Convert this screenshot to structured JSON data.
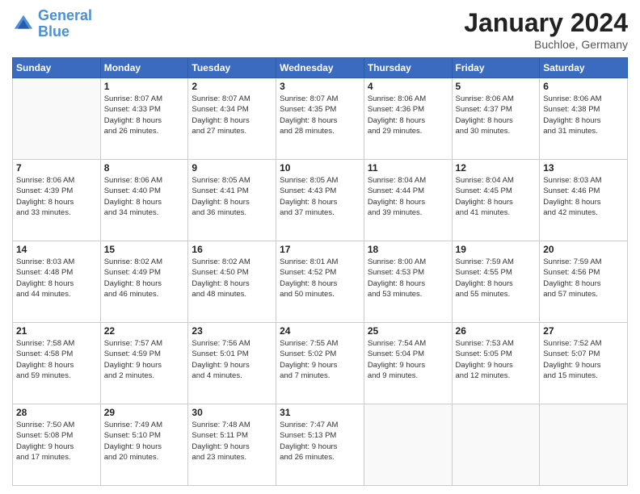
{
  "header": {
    "logo_line1": "General",
    "logo_line2": "Blue",
    "month_title": "January 2024",
    "location": "Buchloe, Germany"
  },
  "weekdays": [
    "Sunday",
    "Monday",
    "Tuesday",
    "Wednesday",
    "Thursday",
    "Friday",
    "Saturday"
  ],
  "weeks": [
    [
      {
        "day": "",
        "info": ""
      },
      {
        "day": "1",
        "info": "Sunrise: 8:07 AM\nSunset: 4:33 PM\nDaylight: 8 hours\nand 26 minutes."
      },
      {
        "day": "2",
        "info": "Sunrise: 8:07 AM\nSunset: 4:34 PM\nDaylight: 8 hours\nand 27 minutes."
      },
      {
        "day": "3",
        "info": "Sunrise: 8:07 AM\nSunset: 4:35 PM\nDaylight: 8 hours\nand 28 minutes."
      },
      {
        "day": "4",
        "info": "Sunrise: 8:06 AM\nSunset: 4:36 PM\nDaylight: 8 hours\nand 29 minutes."
      },
      {
        "day": "5",
        "info": "Sunrise: 8:06 AM\nSunset: 4:37 PM\nDaylight: 8 hours\nand 30 minutes."
      },
      {
        "day": "6",
        "info": "Sunrise: 8:06 AM\nSunset: 4:38 PM\nDaylight: 8 hours\nand 31 minutes."
      }
    ],
    [
      {
        "day": "7",
        "info": "Sunrise: 8:06 AM\nSunset: 4:39 PM\nDaylight: 8 hours\nand 33 minutes."
      },
      {
        "day": "8",
        "info": "Sunrise: 8:06 AM\nSunset: 4:40 PM\nDaylight: 8 hours\nand 34 minutes."
      },
      {
        "day": "9",
        "info": "Sunrise: 8:05 AM\nSunset: 4:41 PM\nDaylight: 8 hours\nand 36 minutes."
      },
      {
        "day": "10",
        "info": "Sunrise: 8:05 AM\nSunset: 4:43 PM\nDaylight: 8 hours\nand 37 minutes."
      },
      {
        "day": "11",
        "info": "Sunrise: 8:04 AM\nSunset: 4:44 PM\nDaylight: 8 hours\nand 39 minutes."
      },
      {
        "day": "12",
        "info": "Sunrise: 8:04 AM\nSunset: 4:45 PM\nDaylight: 8 hours\nand 41 minutes."
      },
      {
        "day": "13",
        "info": "Sunrise: 8:03 AM\nSunset: 4:46 PM\nDaylight: 8 hours\nand 42 minutes."
      }
    ],
    [
      {
        "day": "14",
        "info": "Sunrise: 8:03 AM\nSunset: 4:48 PM\nDaylight: 8 hours\nand 44 minutes."
      },
      {
        "day": "15",
        "info": "Sunrise: 8:02 AM\nSunset: 4:49 PM\nDaylight: 8 hours\nand 46 minutes."
      },
      {
        "day": "16",
        "info": "Sunrise: 8:02 AM\nSunset: 4:50 PM\nDaylight: 8 hours\nand 48 minutes."
      },
      {
        "day": "17",
        "info": "Sunrise: 8:01 AM\nSunset: 4:52 PM\nDaylight: 8 hours\nand 50 minutes."
      },
      {
        "day": "18",
        "info": "Sunrise: 8:00 AM\nSunset: 4:53 PM\nDaylight: 8 hours\nand 53 minutes."
      },
      {
        "day": "19",
        "info": "Sunrise: 7:59 AM\nSunset: 4:55 PM\nDaylight: 8 hours\nand 55 minutes."
      },
      {
        "day": "20",
        "info": "Sunrise: 7:59 AM\nSunset: 4:56 PM\nDaylight: 8 hours\nand 57 minutes."
      }
    ],
    [
      {
        "day": "21",
        "info": "Sunrise: 7:58 AM\nSunset: 4:58 PM\nDaylight: 8 hours\nand 59 minutes."
      },
      {
        "day": "22",
        "info": "Sunrise: 7:57 AM\nSunset: 4:59 PM\nDaylight: 9 hours\nand 2 minutes."
      },
      {
        "day": "23",
        "info": "Sunrise: 7:56 AM\nSunset: 5:01 PM\nDaylight: 9 hours\nand 4 minutes."
      },
      {
        "day": "24",
        "info": "Sunrise: 7:55 AM\nSunset: 5:02 PM\nDaylight: 9 hours\nand 7 minutes."
      },
      {
        "day": "25",
        "info": "Sunrise: 7:54 AM\nSunset: 5:04 PM\nDaylight: 9 hours\nand 9 minutes."
      },
      {
        "day": "26",
        "info": "Sunrise: 7:53 AM\nSunset: 5:05 PM\nDaylight: 9 hours\nand 12 minutes."
      },
      {
        "day": "27",
        "info": "Sunrise: 7:52 AM\nSunset: 5:07 PM\nDaylight: 9 hours\nand 15 minutes."
      }
    ],
    [
      {
        "day": "28",
        "info": "Sunrise: 7:50 AM\nSunset: 5:08 PM\nDaylight: 9 hours\nand 17 minutes."
      },
      {
        "day": "29",
        "info": "Sunrise: 7:49 AM\nSunset: 5:10 PM\nDaylight: 9 hours\nand 20 minutes."
      },
      {
        "day": "30",
        "info": "Sunrise: 7:48 AM\nSunset: 5:11 PM\nDaylight: 9 hours\nand 23 minutes."
      },
      {
        "day": "31",
        "info": "Sunrise: 7:47 AM\nSunset: 5:13 PM\nDaylight: 9 hours\nand 26 minutes."
      },
      {
        "day": "",
        "info": ""
      },
      {
        "day": "",
        "info": ""
      },
      {
        "day": "",
        "info": ""
      }
    ]
  ]
}
